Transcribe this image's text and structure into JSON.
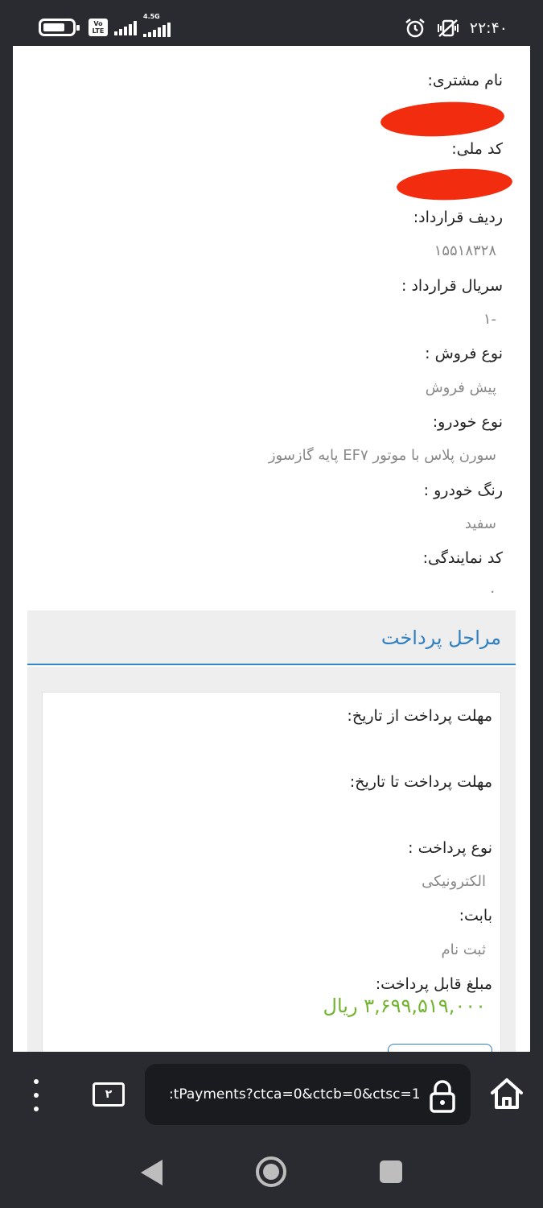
{
  "status_bar": {
    "time": "۲۲:۴۰",
    "network_type": "4.5G",
    "volte": "Vo LTE"
  },
  "contract": {
    "fields": [
      {
        "label": "نام مشتری:",
        "value": ""
      },
      {
        "label": "کد ملی:",
        "value": ""
      },
      {
        "label": "ردیف قرارداد:",
        "value": "۱۵۵۱۸۳۲۸"
      },
      {
        "label": "سریال قرارداد :",
        "value": "-۱"
      },
      {
        "label": "نوع فروش :",
        "value": "پیش فروش"
      },
      {
        "label": "نوع خودرو:",
        "value": "سورن پلاس با موتور EF۷ پایه گازسوز"
      },
      {
        "label": "رنگ خودرو :",
        "value": "سفید"
      },
      {
        "label": "کد نمایندگی:",
        "value": "۰"
      }
    ]
  },
  "payment": {
    "title": "مراحل پرداخت",
    "fields": [
      {
        "label": "مهلت پرداخت از تاریخ:",
        "value": ""
      },
      {
        "label": "مهلت پرداخت تا تاریخ:",
        "value": ""
      },
      {
        "label": "نوع پرداخت :",
        "value": "الکترونیکی"
      },
      {
        "label": "بابت:",
        "value": "ثبت نام"
      },
      {
        "label": "مبلغ قابل پرداخت:",
        "value": ""
      }
    ],
    "amount": "۳,۶۹۹,۵۱۹,۰۰۰ ریال"
  },
  "browser": {
    "tab_count": "۲",
    "url": ":tPayments?ctca=0&ctcb=0&ctsc=1"
  },
  "colors": {
    "accent_blue": "#2f7fc1",
    "amount_green": "#72b430",
    "redaction_red": "#f22c0f"
  }
}
